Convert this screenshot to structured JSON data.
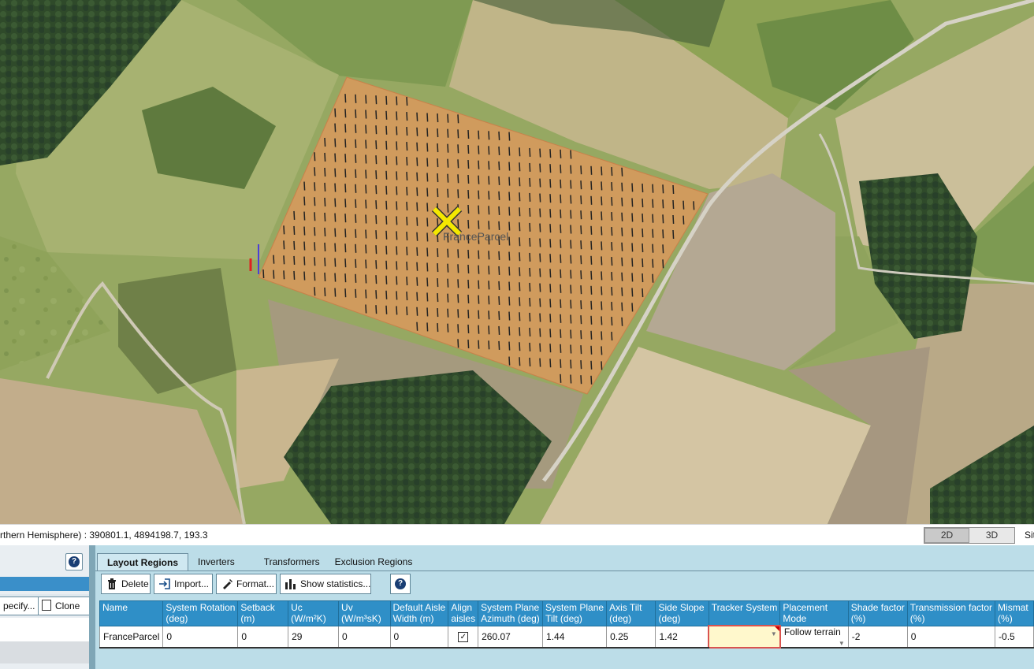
{
  "map": {
    "parcel_label": "FranceParcel",
    "colors": {
      "parcel_fill": "#e0975c",
      "marker": "#f4e800"
    }
  },
  "status": {
    "coords": "rthern Hemisphere)  : 390801.1, 4894198.7, 193.3",
    "view_2d": "2D",
    "view_3d": "3D",
    "active_view": "2D",
    "site_label": "Sit"
  },
  "left_panel": {
    "help_icon": "help-icon",
    "specify_label": "pecify...",
    "clone_label": "Clone"
  },
  "tabs": [
    "Layout Regions",
    "Inverters",
    "Transformers",
    "Exclusion Regions"
  ],
  "active_tab": "Layout Regions",
  "toolbar": {
    "delete_label": "Delete",
    "import_label": "Import...",
    "format_label": "Format...",
    "stats_label": "Show statistics..."
  },
  "grid": {
    "columns": [
      {
        "line1": "Name",
        "line2": ""
      },
      {
        "line1": "System Rotation",
        "line2": "(deg)"
      },
      {
        "line1": "Setback",
        "line2": "(m)"
      },
      {
        "line1": "Uc",
        "line2": "(W/m²K)"
      },
      {
        "line1": "Uv",
        "line2": "(W/m³sK)"
      },
      {
        "line1": "Default Aisle",
        "line2": "Width (m)"
      },
      {
        "line1": "Align",
        "line2": "aisles"
      },
      {
        "line1": "System Plane",
        "line2": "Azimuth (deg)"
      },
      {
        "line1": "System Plane",
        "line2": "Tilt (deg)"
      },
      {
        "line1": "Axis Tilt",
        "line2": "(deg)"
      },
      {
        "line1": "Side Slope",
        "line2": "(deg)"
      },
      {
        "line1": "Tracker System",
        "line2": ""
      },
      {
        "line1": "Placement",
        "line2": "Mode"
      },
      {
        "line1": "Shade factor",
        "line2": "(%)"
      },
      {
        "line1": "Transmission factor",
        "line2": "(%)"
      },
      {
        "line1": "Mismat",
        "line2": "(%)"
      }
    ],
    "row": {
      "name": "FranceParcel",
      "system_rotation": "0",
      "setback": "0",
      "uc": "29",
      "uv": "0",
      "aisle_width": "0",
      "align_aisles": "✓",
      "azimuth": "260.07",
      "plane_tilt": "1.44",
      "axis_tilt": "0.25",
      "side_slope": "1.42",
      "tracker_system": "",
      "placement_mode": "Follow terrain",
      "shade_factor": "-2",
      "transmission_factor": "0",
      "mismatch": "-0.5"
    }
  }
}
